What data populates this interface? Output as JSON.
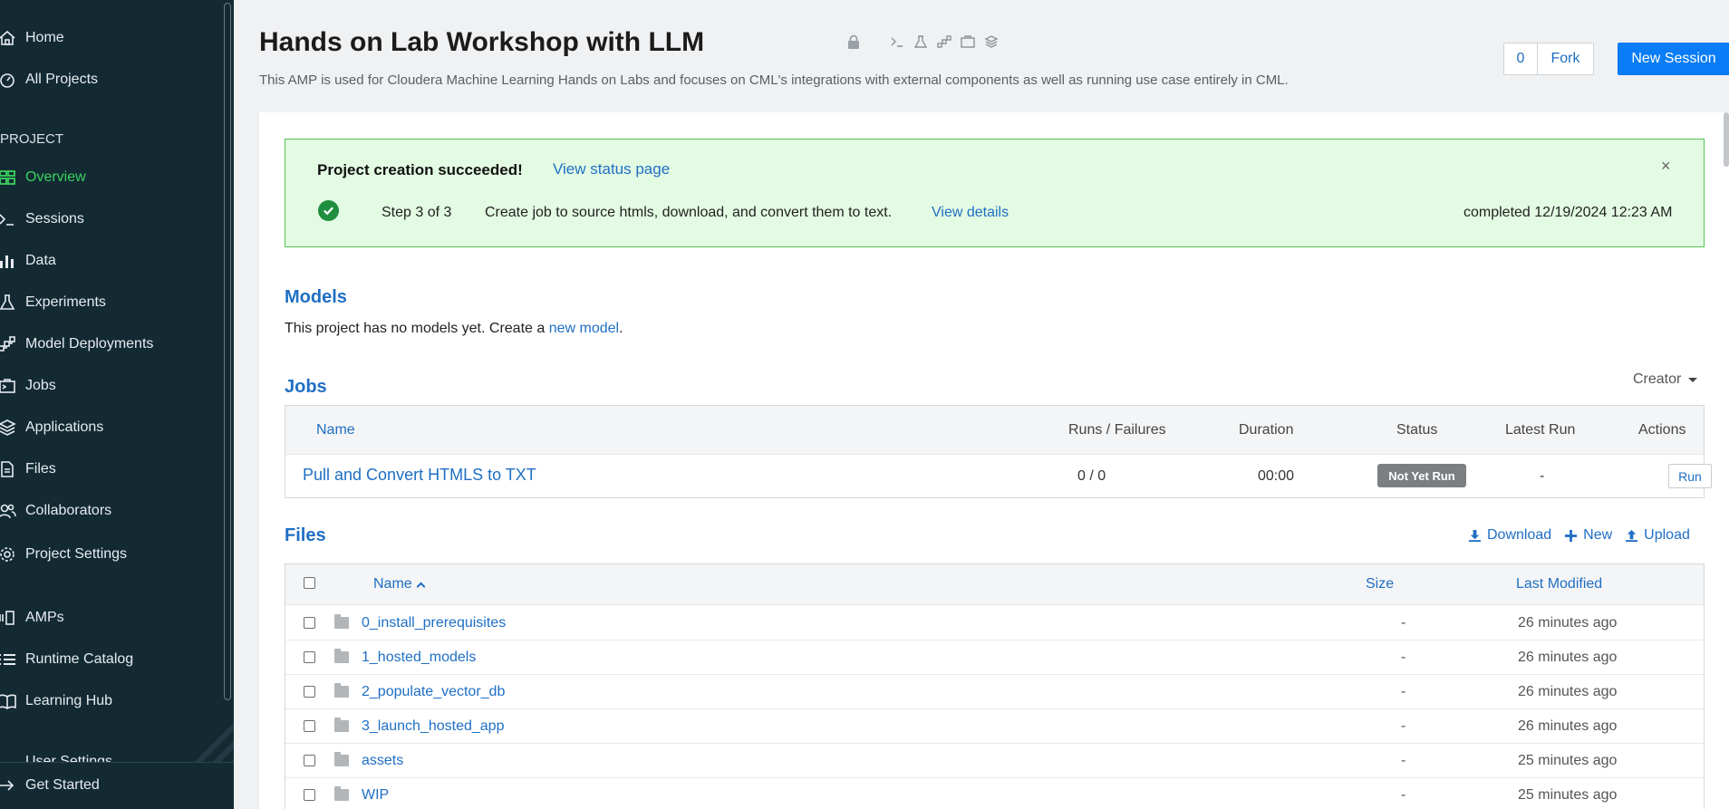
{
  "sidebar": {
    "items": [
      {
        "label": "Home",
        "icon": "home-icon"
      },
      {
        "label": "All Projects",
        "icon": "gauge-icon"
      }
    ],
    "section_label": "PROJECT",
    "project_items": [
      {
        "label": "Overview",
        "icon": "grid-icon",
        "active": true
      },
      {
        "label": "Sessions",
        "icon": "terminal-icon"
      },
      {
        "label": "Data",
        "icon": "bar-chart-icon"
      },
      {
        "label": "Experiments",
        "icon": "flask-icon"
      },
      {
        "label": "Model Deployments",
        "icon": "model-icon"
      },
      {
        "label": "Jobs",
        "icon": "jobs-icon"
      },
      {
        "label": "Applications",
        "icon": "layers-icon"
      },
      {
        "label": "Files",
        "icon": "file-icon"
      },
      {
        "label": "Collaborators",
        "icon": "users-icon"
      },
      {
        "label": "Project Settings",
        "icon": "gear-icon"
      }
    ],
    "extra_items": [
      {
        "label": "AMPs",
        "icon": "amp-icon"
      },
      {
        "label": "Runtime Catalog",
        "icon": "list-icon"
      },
      {
        "label": "Learning Hub",
        "icon": "book-icon"
      }
    ],
    "cut_item": "User Settings",
    "footer_item": {
      "label": "Get Started",
      "icon": "arrow-right-icon"
    }
  },
  "header": {
    "title": "Hands on Lab Workshop with LLM",
    "description": "This AMP is used for Cloudera Machine Learning Hands on Labs and focuses on CML's integrations with external components as well as running use case entirely in CML.",
    "fork_count": "0",
    "fork_label": "Fork",
    "new_session_label": "New Session"
  },
  "alert": {
    "title": "Project creation succeeded!",
    "status_link": "View status page",
    "step": "Step 3 of 3",
    "description": "Create job to source htmls, download, and convert them to text.",
    "details_link": "View details",
    "completed": "completed 12/19/2024 12:23 AM",
    "close": "×"
  },
  "models": {
    "title": "Models",
    "text_prefix": "This project has no models yet. Create a ",
    "link": "new model",
    "text_suffix": "."
  },
  "jobs": {
    "title": "Jobs",
    "filter_label": "Creator",
    "columns": {
      "name": "Name",
      "runs": "Runs / Failures",
      "duration": "Duration",
      "status": "Status",
      "latest": "Latest Run",
      "actions": "Actions"
    },
    "rows": [
      {
        "name": "Pull and Convert HTMLS to TXT",
        "runs": "0 / 0",
        "duration": "00:00",
        "status": "Not Yet Run",
        "latest": "-",
        "action": "Run"
      }
    ]
  },
  "files": {
    "title": "Files",
    "actions": {
      "download": "Download",
      "new": "New",
      "upload": "Upload"
    },
    "columns": {
      "name": "Name",
      "size": "Size",
      "modified": "Last Modified"
    },
    "rows": [
      {
        "name": "0_install_prerequisites",
        "size": "-",
        "modified": "26 minutes ago"
      },
      {
        "name": "1_hosted_models",
        "size": "-",
        "modified": "26 minutes ago"
      },
      {
        "name": "2_populate_vector_db",
        "size": "-",
        "modified": "26 minutes ago"
      },
      {
        "name": "3_launch_hosted_app",
        "size": "-",
        "modified": "26 minutes ago"
      },
      {
        "name": "assets",
        "size": "-",
        "modified": "25 minutes ago"
      },
      {
        "name": "WIP",
        "size": "-",
        "modified": "25 minutes ago"
      }
    ]
  },
  "colors": {
    "sidebar_bg": "#132a33",
    "active": "#3ad25f",
    "link": "#1f6fc4",
    "primary_button": "#0a7cf5",
    "success_bg": "#e3fbe3",
    "success_border": "#52c252"
  }
}
